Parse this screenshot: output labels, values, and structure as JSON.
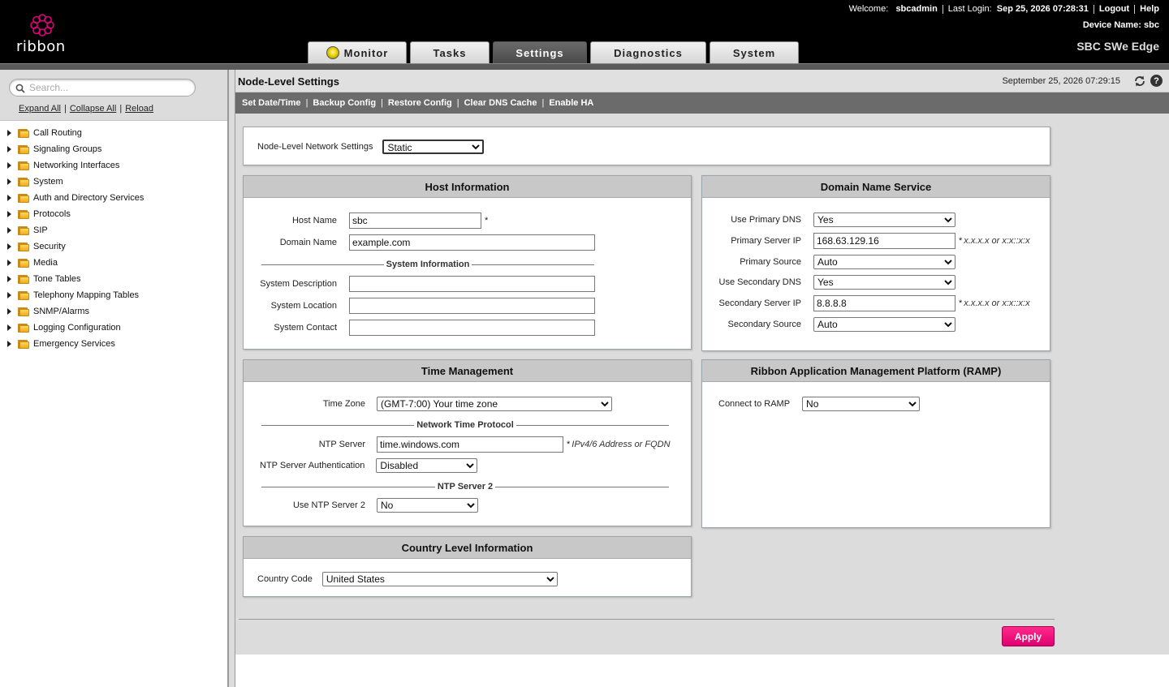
{
  "brand": {
    "logo_text": "ribbon",
    "product": "SBC SWe Edge",
    "accent": "#e0007a"
  },
  "topnav": {
    "welcome_label": "Welcome:",
    "user": "sbcadmin",
    "last_login_label": "Last Login:",
    "last_login": "Sep 25, 2026 07:28:31",
    "logout": "Logout",
    "help": "Help",
    "device_label": "Device Name:",
    "device_name": "sbc"
  },
  "tabs": [
    {
      "label": "Monitor",
      "active": false
    },
    {
      "label": "Tasks",
      "active": false
    },
    {
      "label": "Settings",
      "active": true
    },
    {
      "label": "Diagnostics",
      "active": false
    },
    {
      "label": "System",
      "active": false
    }
  ],
  "sidebar": {
    "search_placeholder": "Search...",
    "expand_all": "Expand All",
    "collapse_all": "Collapse All",
    "reload": "Reload",
    "items": [
      "Call Routing",
      "Signaling Groups",
      "Networking Interfaces",
      "System",
      "Auth and Directory Services",
      "Protocols",
      "SIP",
      "Security",
      "Media",
      "Tone Tables",
      "Telephony Mapping Tables",
      "SNMP/Alarms",
      "Logging Configuration",
      "Emergency Services"
    ]
  },
  "page": {
    "title": "Node-Level Settings",
    "datetime": "September 25, 2026 07:29:15",
    "actions": [
      "Set Date/Time",
      "Backup Config",
      "Restore Config",
      "Clear DNS Cache",
      "Enable HA"
    ]
  },
  "network": {
    "label": "Node-Level Network Settings",
    "value": "Static"
  },
  "host": {
    "title": "Host Information",
    "host_name_label": "Host Name",
    "host_name": "sbc",
    "domain_label": "Domain Name",
    "domain": "example.com",
    "sysinfo_legend": "System Information",
    "desc_label": "System Description",
    "desc": "",
    "location_label": "System Location",
    "location": "",
    "contact_label": "System Contact",
    "contact": ""
  },
  "dns": {
    "title": "Domain Name Service",
    "use_primary_label": "Use Primary DNS",
    "use_primary": "Yes",
    "primary_ip_label": "Primary Server IP",
    "primary_ip": "168.63.129.16",
    "ip_hint": "x.x.x.x or x:x::x:x",
    "primary_source_label": "Primary Source",
    "primary_source": "Auto",
    "use_secondary_label": "Use Secondary DNS",
    "use_secondary": "Yes",
    "secondary_ip_label": "Secondary Server IP",
    "secondary_ip": "8.8.8.8",
    "secondary_source_label": "Secondary Source",
    "secondary_source": "Auto"
  },
  "time": {
    "title": "Time Management",
    "tz_label": "Time Zone",
    "tz": "(GMT-7:00) Your time zone",
    "ntp_legend": "Network Time Protocol",
    "ntp_server_label": "NTP Server",
    "ntp_server": "time.windows.com",
    "ntp_hint": "IPv4/6 Address or FQDN",
    "ntp_auth_label": "NTP Server Authentication",
    "ntp_auth": "Disabled",
    "ntp2_legend": "NTP Server 2",
    "ntp2_label": "Use NTP Server 2",
    "ntp2": "No"
  },
  "ramp": {
    "title": "Ribbon Application Management Platform (RAMP)",
    "connect_label": "Connect to RAMP",
    "connect": "No"
  },
  "country": {
    "title": "Country Level Information",
    "code_label": "Country Code",
    "code": "United States"
  },
  "apply_label": "Apply"
}
